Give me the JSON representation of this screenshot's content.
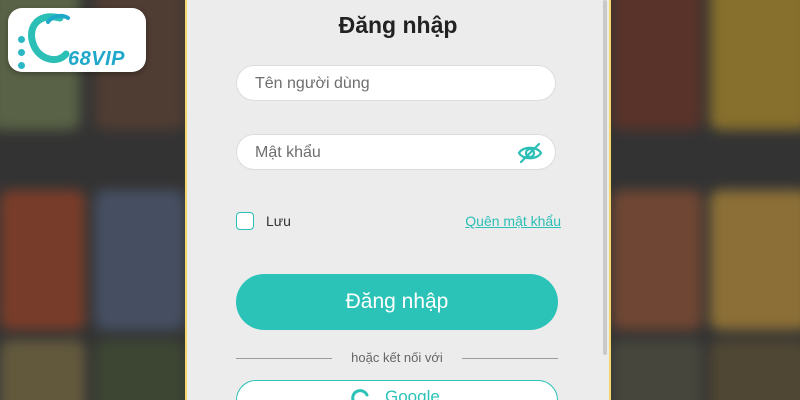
{
  "brand": {
    "logo_text": "68VIP",
    "accent_color": "#2bc3b8",
    "logo_color": "#1fa8c9"
  },
  "login": {
    "title": "Đăng nhập",
    "username_placeholder": "Tên người dùng",
    "password_placeholder": "Mật khẩu",
    "remember_label": "Lưu",
    "forgot_link": "Quên mật khẩu",
    "submit_label": "Đăng nhập",
    "divider_text": "hoặc kết nối với",
    "google_label": "Google"
  },
  "icons": {
    "password_toggle": "eye-off-icon",
    "google": "google-icon",
    "logo": "68vip-logo"
  }
}
